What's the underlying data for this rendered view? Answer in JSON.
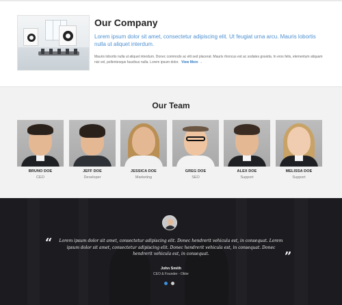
{
  "company": {
    "title_light": "Our",
    "title_bold": "Company",
    "lead": "Lorem ipsum dolor sit amet, consectetur adipiscing elit. Ut feugiat urna arcu. Mauris lobortis nulla ut aliquet interdum.",
    "text": "Mauris lobortis nulla ut aliquet interdum. Donec commodo ac elit sed placerat. Mauris rhoncus est ac sodales gravida. In eros felis, elementum aliquam nisi vel, pellentesque faucibus nulla. Lorem ipsum dolor.",
    "view_more": "View More →"
  },
  "team": {
    "title_light": "Our",
    "title_bold": "Team",
    "members": [
      {
        "name": "BRUNO DOE",
        "role": "CEO"
      },
      {
        "name": "JEFF DOE",
        "role": "Developer"
      },
      {
        "name": "JESSICA DOE",
        "role": "Marketing"
      },
      {
        "name": "GREG DOE",
        "role": "SEO"
      },
      {
        "name": "ALEX DOE",
        "role": "Support"
      },
      {
        "name": "MELISSA DOE",
        "role": "Support"
      }
    ]
  },
  "testimonial": {
    "quote": "Lorem ipsum dolor sit amet, consectetur adipiscing elit. Donec hendrerit vehicula est, in consequat. Lorem ipsum dolor sit amet, consectetur adipiscing elit. Donec hendrerit vehicula est, in consequat. Donec hendrerit vehicula est, in consequat.",
    "author": "John Smith",
    "author_role": "CEO & Founder - Okler",
    "open_mark": "“",
    "close_mark": "”",
    "slide_count": 2,
    "active_slide": 1
  },
  "colors": {
    "accent": "#4b8fd0",
    "link": "#2e79c5",
    "dot_active": "#3e8fe0",
    "dark_bg": "#1f2124",
    "team_bg": "#f2f2f2"
  }
}
